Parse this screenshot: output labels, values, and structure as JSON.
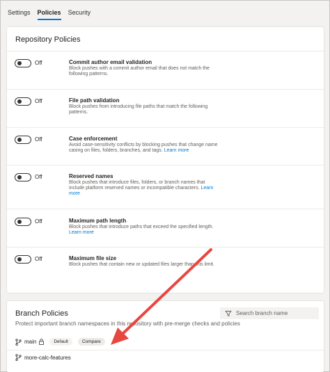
{
  "tabs": [
    {
      "label": "Settings",
      "active": false
    },
    {
      "label": "Policies",
      "active": true
    },
    {
      "label": "Security",
      "active": false
    }
  ],
  "repository_policies": {
    "title": "Repository Policies",
    "policies": [
      {
        "state": "Off",
        "title": "Commit author email validation",
        "description": "Block pushes with a commit author email that does not match the following patterns.",
        "link": ""
      },
      {
        "state": "Off",
        "title": "File path validation",
        "description": "Block pushes from introducing file paths that match the following patterns.",
        "link": ""
      },
      {
        "state": "Off",
        "title": "Case enforcement",
        "description": "Avoid case-sensitivity conflicts by blocking pushes that change name casing on files, folders, branches, and tags.",
        "link": "Learn more"
      },
      {
        "state": "Off",
        "title": "Reserved names",
        "description": "Block pushes that introduce files, folders, or branch names that include platform reserved names or incompatible characters.",
        "link": "Learn more"
      },
      {
        "state": "Off",
        "title": "Maximum path length",
        "description": "Block pushes that introduce paths that exceed the specified length.",
        "link": "Learn more"
      },
      {
        "state": "Off",
        "title": "Maximum file size",
        "description": "Block pushes that contain new or updated files larger than this limit.",
        "link": ""
      }
    ]
  },
  "branch_policies": {
    "title": "Branch Policies",
    "search_placeholder": "Search branch name",
    "description": "Protect important branch namespaces in this repository with pre-merge checks and policies",
    "branches": [
      {
        "name": "main",
        "badges": [
          "Default",
          "Compare"
        ]
      },
      {
        "name": "more-calc-features",
        "badges": []
      }
    ]
  },
  "colors": {
    "accent": "#0078d4",
    "annotation_arrow": "#e8473f"
  }
}
